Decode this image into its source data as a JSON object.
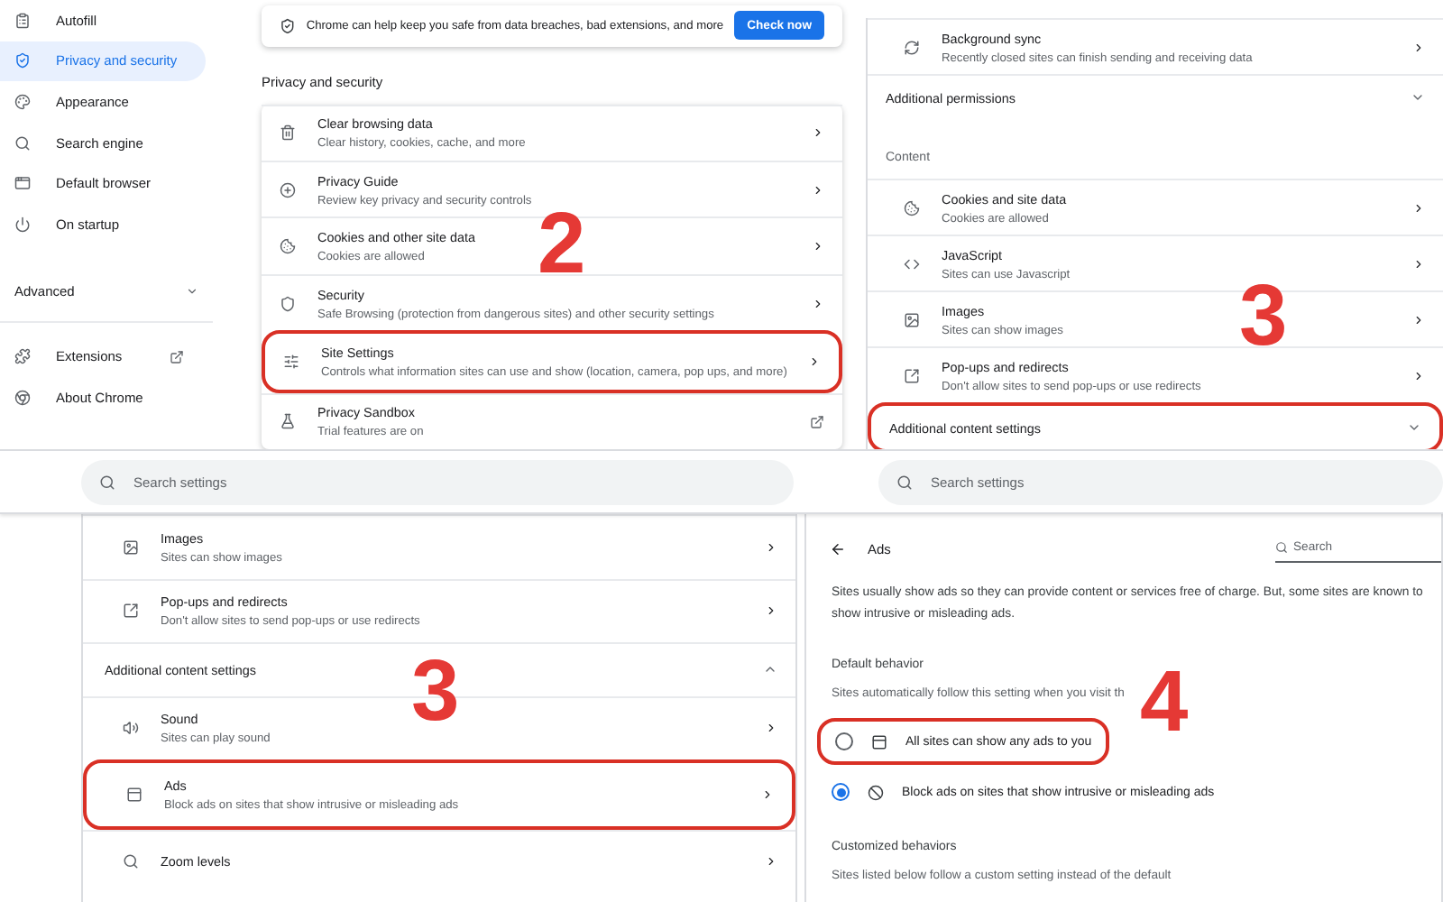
{
  "panels": [
    {
      "kind": "main",
      "step": "2",
      "sidebar": {
        "items": [
          {
            "label": "Autofill",
            "selected": false
          },
          {
            "label": "Privacy and security",
            "selected": true
          },
          {
            "label": "Appearance",
            "selected": false
          },
          {
            "label": "Search engine",
            "selected": false
          },
          {
            "label": "Default browser",
            "selected": false
          },
          {
            "label": "On startup",
            "selected": false
          }
        ],
        "advanced": {
          "label": "Advanced",
          "expanded": false
        },
        "links": [
          {
            "label": "Extensions"
          },
          {
            "label": "About Chrome"
          }
        ]
      },
      "banner": {
        "text": "Chrome can help keep you safe from data breaches, bad extensions, and more",
        "button": "Check now"
      },
      "section_title": "Privacy and security",
      "items": [
        {
          "kind": "row",
          "title": "Clear browsing data",
          "subtitle": "Clear history, cookies, cache, and more",
          "highlighted": false
        },
        {
          "kind": "row",
          "title": "Privacy Guide",
          "subtitle": "Review key privacy and security controls",
          "highlighted": false
        },
        {
          "kind": "row",
          "title": "Cookies and other site data",
          "subtitle": "Cookies are allowed",
          "highlighted": false
        },
        {
          "kind": "row",
          "title": "Security",
          "subtitle": "Safe Browsing (protection from dangerous sites) and other security settings",
          "highlighted": false
        },
        {
          "kind": "row",
          "title": "Site Settings",
          "subtitle": "Controls what information sites can use and show (location, camera, pop ups, and more)",
          "highlighted": true
        },
        {
          "kind": "link",
          "title": "Privacy Sandbox",
          "subtitle": "Trial features are on",
          "highlighted": false
        }
      ]
    },
    {
      "kind": "list",
      "step": "3",
      "items": [
        {
          "kind": "row",
          "title": "Background sync",
          "subtitle": "Recently closed sites can finish sending and receiving data",
          "highlighted": false
        },
        {
          "kind": "expander",
          "title": "Additional permissions",
          "expanded": false,
          "highlighted": false
        },
        {
          "kind": "heading",
          "title": "Content"
        },
        {
          "kind": "row",
          "title": "Cookies and site data",
          "subtitle": "Cookies are allowed",
          "highlighted": false
        },
        {
          "kind": "row",
          "title": "JavaScript",
          "subtitle": "Sites can use Javascript",
          "highlighted": false
        },
        {
          "kind": "row",
          "title": "Images",
          "subtitle": "Sites can show images",
          "highlighted": false
        },
        {
          "kind": "row",
          "title": "Pop-ups and redirects",
          "subtitle": "Don't allow sites to send pop-ups or use redirects",
          "highlighted": false
        },
        {
          "kind": "expander",
          "title": "Additional content settings",
          "expanded": false,
          "highlighted": true
        }
      ]
    },
    {
      "kind": "list",
      "step": "3",
      "search": {
        "placeholder": "Search settings"
      },
      "items": [
        {
          "kind": "row",
          "title": "Images",
          "subtitle": "Sites can show images",
          "highlighted": false
        },
        {
          "kind": "row",
          "title": "Pop-ups and redirects",
          "subtitle": "Don't allow sites to send pop-ups or use redirects",
          "highlighted": false
        },
        {
          "kind": "expander",
          "title": "Additional content settings",
          "expanded": true,
          "highlighted": false
        },
        {
          "kind": "row",
          "title": "Sound",
          "subtitle": "Sites can play sound",
          "highlighted": false
        },
        {
          "kind": "row",
          "title": "Ads",
          "subtitle": "Block ads on sites that show intrusive or misleading ads",
          "highlighted": true
        },
        {
          "kind": "row",
          "title": "Zoom levels",
          "highlighted": false
        }
      ]
    },
    {
      "kind": "detail",
      "step": "4",
      "search": {
        "placeholder": "Search settings"
      },
      "title": "Ads",
      "page_search": {
        "placeholder": "Search"
      },
      "description": "Sites usually show ads so they can provide content or services free of charge. But, some sites are known to show intrusive or misleading ads.",
      "default_heading": "Default behavior",
      "default_note": "Sites automatically follow this setting when you visit th",
      "options": [
        {
          "label": "All sites can show any ads to you",
          "selected": false,
          "highlighted": true
        },
        {
          "label": "Block ads on sites that show intrusive or misleading ads",
          "selected": true,
          "highlighted": false
        }
      ],
      "custom_heading": "Customized behaviors",
      "custom_note": "Sites listed below follow a custom setting instead of the default"
    }
  ]
}
